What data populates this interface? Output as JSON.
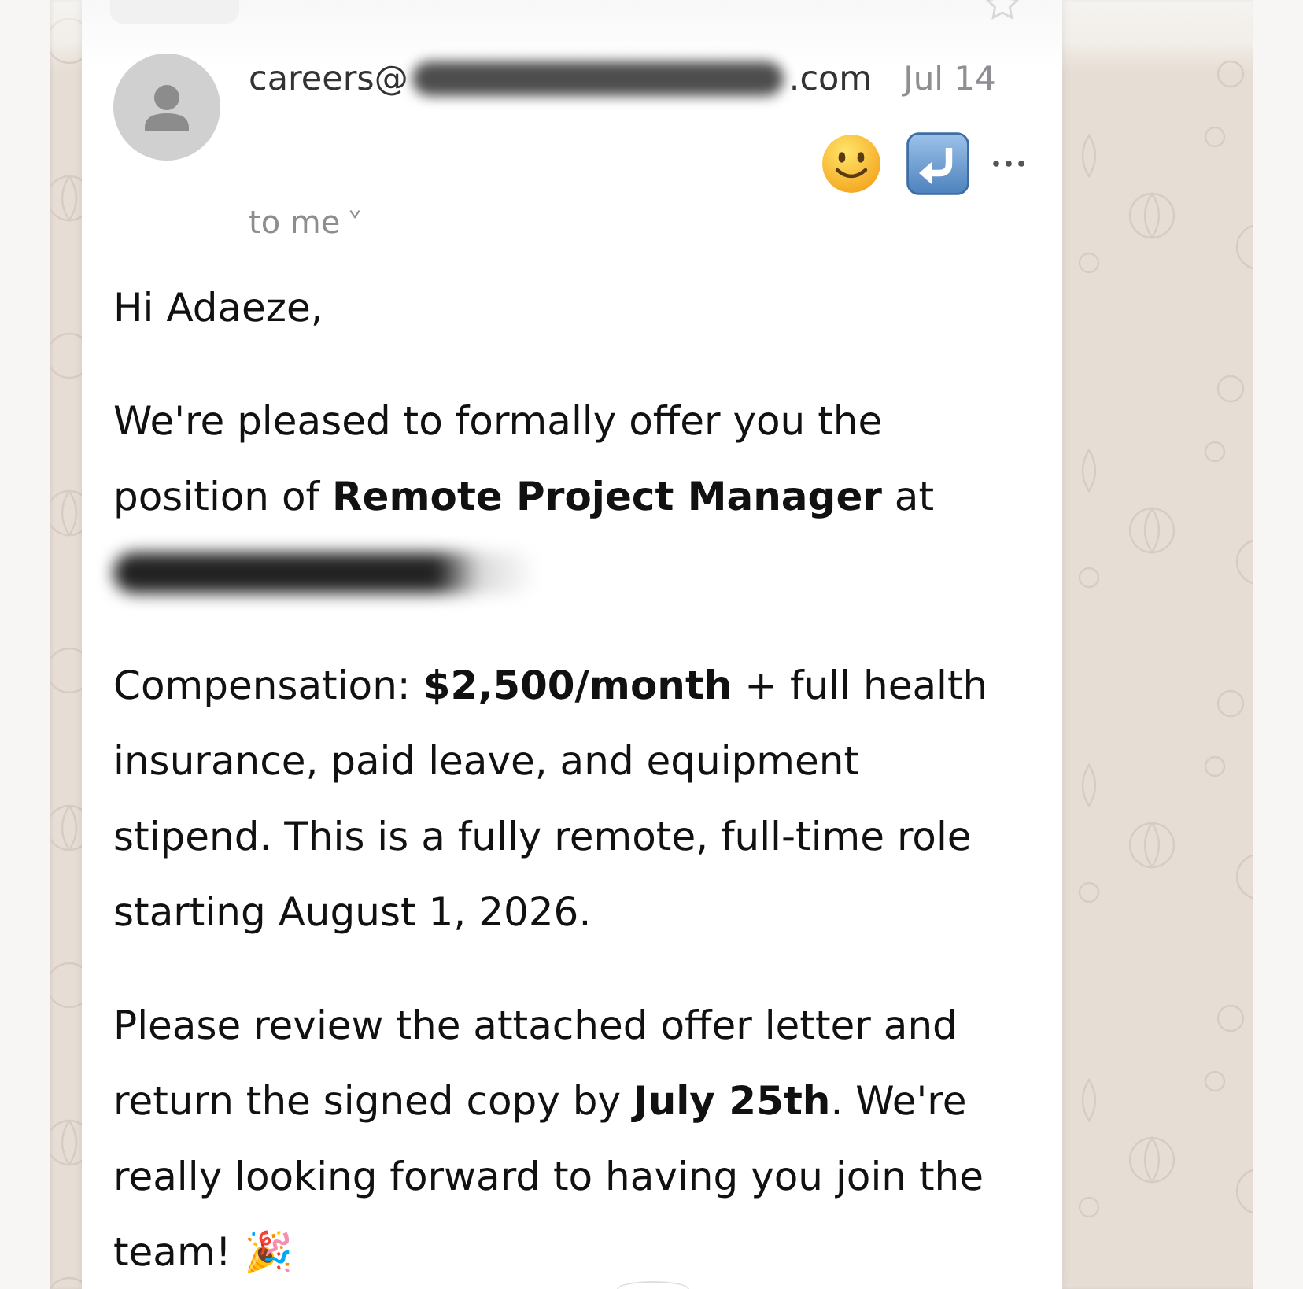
{
  "message": {
    "sender_parts": [
      {
        "kind": "text",
        "text": "careers@"
      },
      {
        "kind": "redacted"
      },
      {
        "kind": "text",
        "text": ".com"
      }
    ],
    "date": "Jul 14",
    "recipient": "to me"
  },
  "body": [
    {
      "kind": "paragraph",
      "text": "Hi Adaeze,"
    },
    {
      "kind": "paragraph",
      "text": "We're pleased to formally offer you the position of **Remote Project Manager** at"
    },
    {
      "kind": "redacted"
    },
    {
      "kind": "paragraph",
      "text": "Compensation: **$2,500/month** + full health insurance, paid leave, and equipment stipend. This is a fully remote, full-time role starting August 1, 2026."
    },
    {
      "kind": "paragraph",
      "text": "Please review the attached offer letter and return the signed copy by **July 25th**. We're really looking forward to having you join the team! 🎉"
    }
  ]
}
